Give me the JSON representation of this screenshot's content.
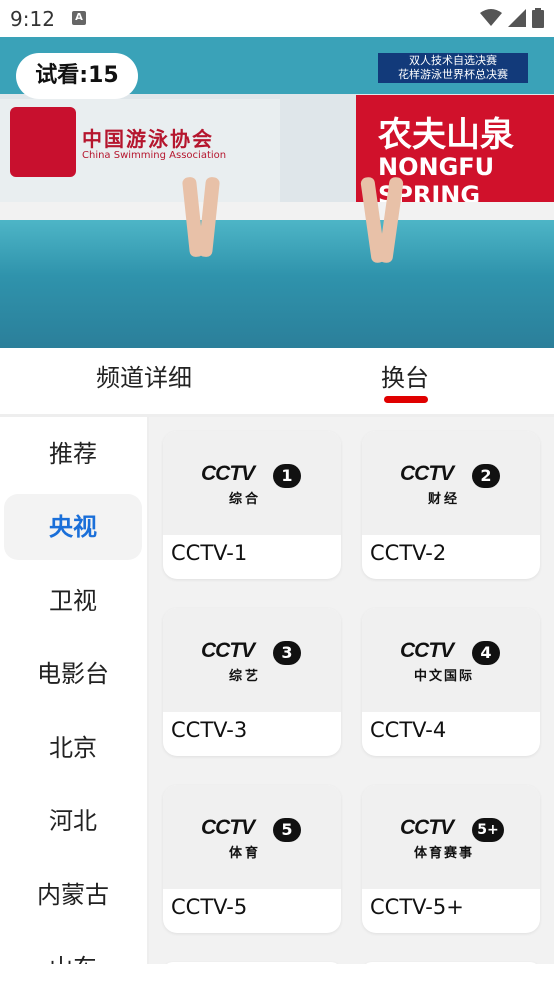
{
  "status_bar": {
    "time": "9:12",
    "notification_glyph": "A"
  },
  "video": {
    "trial_label": "试看:15",
    "caption_line1": "双人技术自选决赛",
    "caption_line2": "花样游泳世界杯总决赛",
    "banner_left_text": "中国游泳协会",
    "banner_left_sub": "China Swimming Association",
    "banner_right_text": "农夫山泉",
    "banner_right_sub": "NONGFU SPRING"
  },
  "tabs": [
    {
      "label": "频道详细",
      "active": false
    },
    {
      "label": "换台",
      "active": true
    }
  ],
  "sidebar": {
    "items": [
      {
        "label": "推荐",
        "active": false
      },
      {
        "label": "央视",
        "active": true
      },
      {
        "label": "卫视",
        "active": false
      },
      {
        "label": "电影台",
        "active": false
      },
      {
        "label": "北京",
        "active": false
      },
      {
        "label": "河北",
        "active": false
      },
      {
        "label": "内蒙古",
        "active": false
      },
      {
        "label": "山东",
        "active": false
      }
    ]
  },
  "channels": [
    {
      "name": "CCTV-1",
      "logo_word": "CCTV",
      "logo_number": "1",
      "logo_sub": "综合"
    },
    {
      "name": "CCTV-2",
      "logo_word": "CCTV",
      "logo_number": "2",
      "logo_sub": "财经"
    },
    {
      "name": "CCTV-3",
      "logo_word": "CCTV",
      "logo_number": "3",
      "logo_sub": "综艺"
    },
    {
      "name": "CCTV-4",
      "logo_word": "CCTV",
      "logo_number": "4",
      "logo_sub": "中文国际"
    },
    {
      "name": "CCTV-5",
      "logo_word": "CCTV",
      "logo_number": "5",
      "logo_sub": "体育"
    },
    {
      "name": "CCTV-5+",
      "logo_word": "CCTV",
      "logo_number": "5+",
      "logo_sub": "体育赛事"
    }
  ],
  "colors": {
    "accent": "#1a6fd9",
    "indicator": "#e00000"
  }
}
